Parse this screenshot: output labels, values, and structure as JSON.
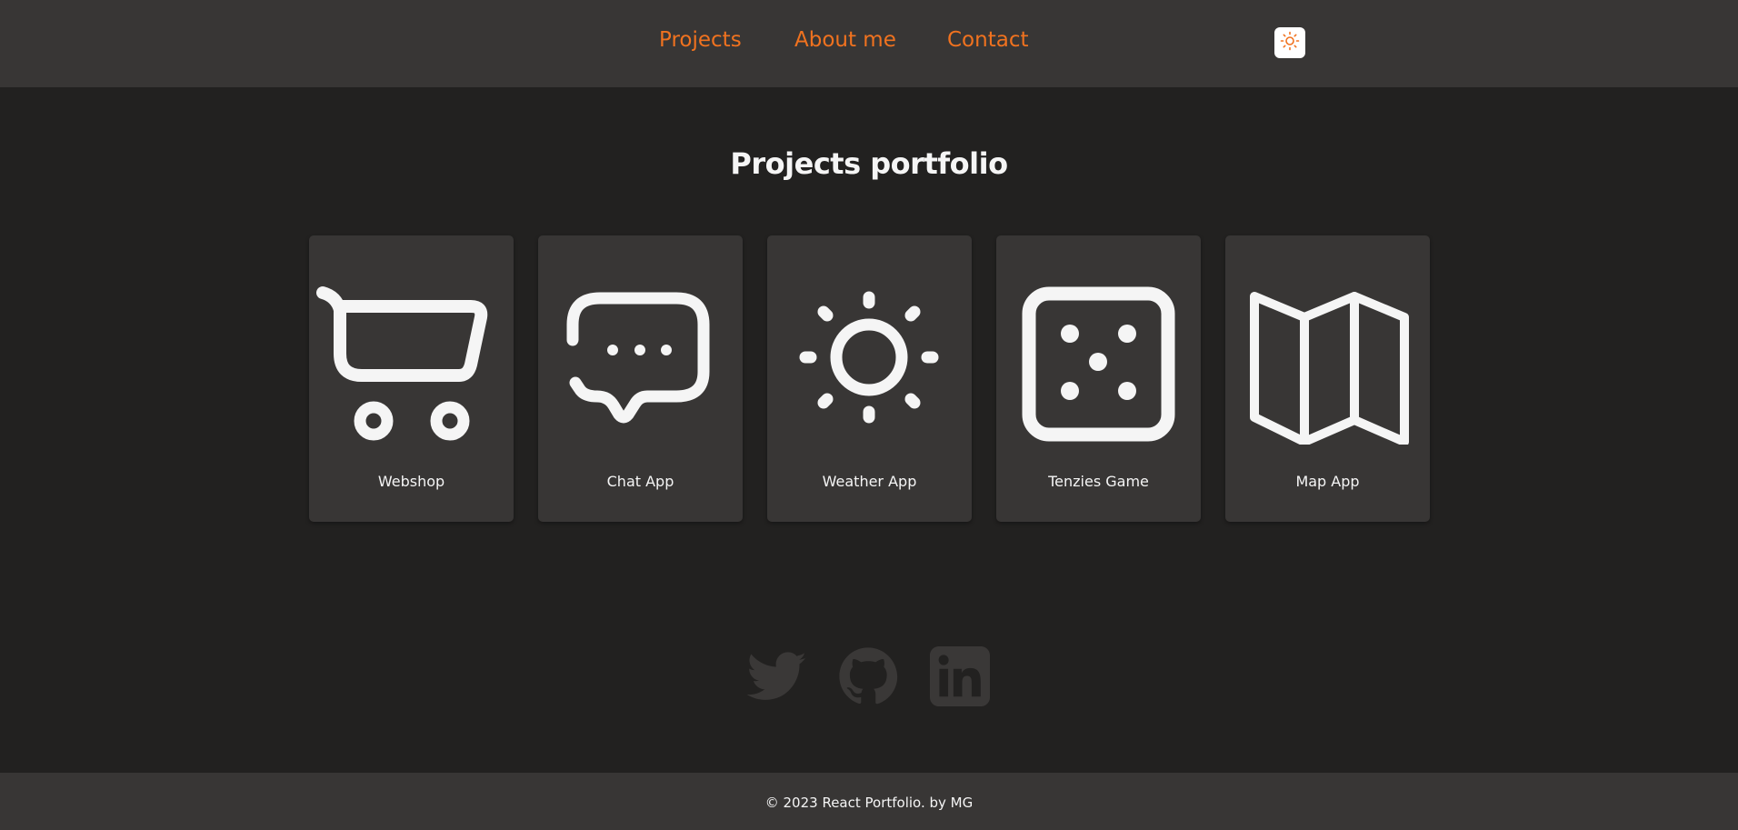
{
  "nav": {
    "links": [
      {
        "label": "Projects"
      },
      {
        "label": "About me"
      },
      {
        "label": "Contact"
      }
    ],
    "theme_toggle_icon": "sun-icon"
  },
  "main": {
    "title": "Projects portfolio",
    "projects": [
      {
        "label": "Webshop",
        "icon": "shopping-cart-icon"
      },
      {
        "label": "Chat App",
        "icon": "chat-bubble-icon"
      },
      {
        "label": "Weather App",
        "icon": "sun-icon"
      },
      {
        "label": "Tenzies Game",
        "icon": "dice-icon"
      },
      {
        "label": "Map App",
        "icon": "map-icon"
      }
    ]
  },
  "social": [
    {
      "icon": "twitter-icon"
    },
    {
      "icon": "github-icon"
    },
    {
      "icon": "linkedin-icon"
    }
  ],
  "footer": {
    "text": "© 2023 React Portfolio. by MG"
  },
  "colors": {
    "accent": "#f0721f",
    "header_bg": "#383635",
    "page_bg": "#222120",
    "card_bg": "#383635",
    "text": "#f5f5f5",
    "social_icon": "#3a3837"
  }
}
